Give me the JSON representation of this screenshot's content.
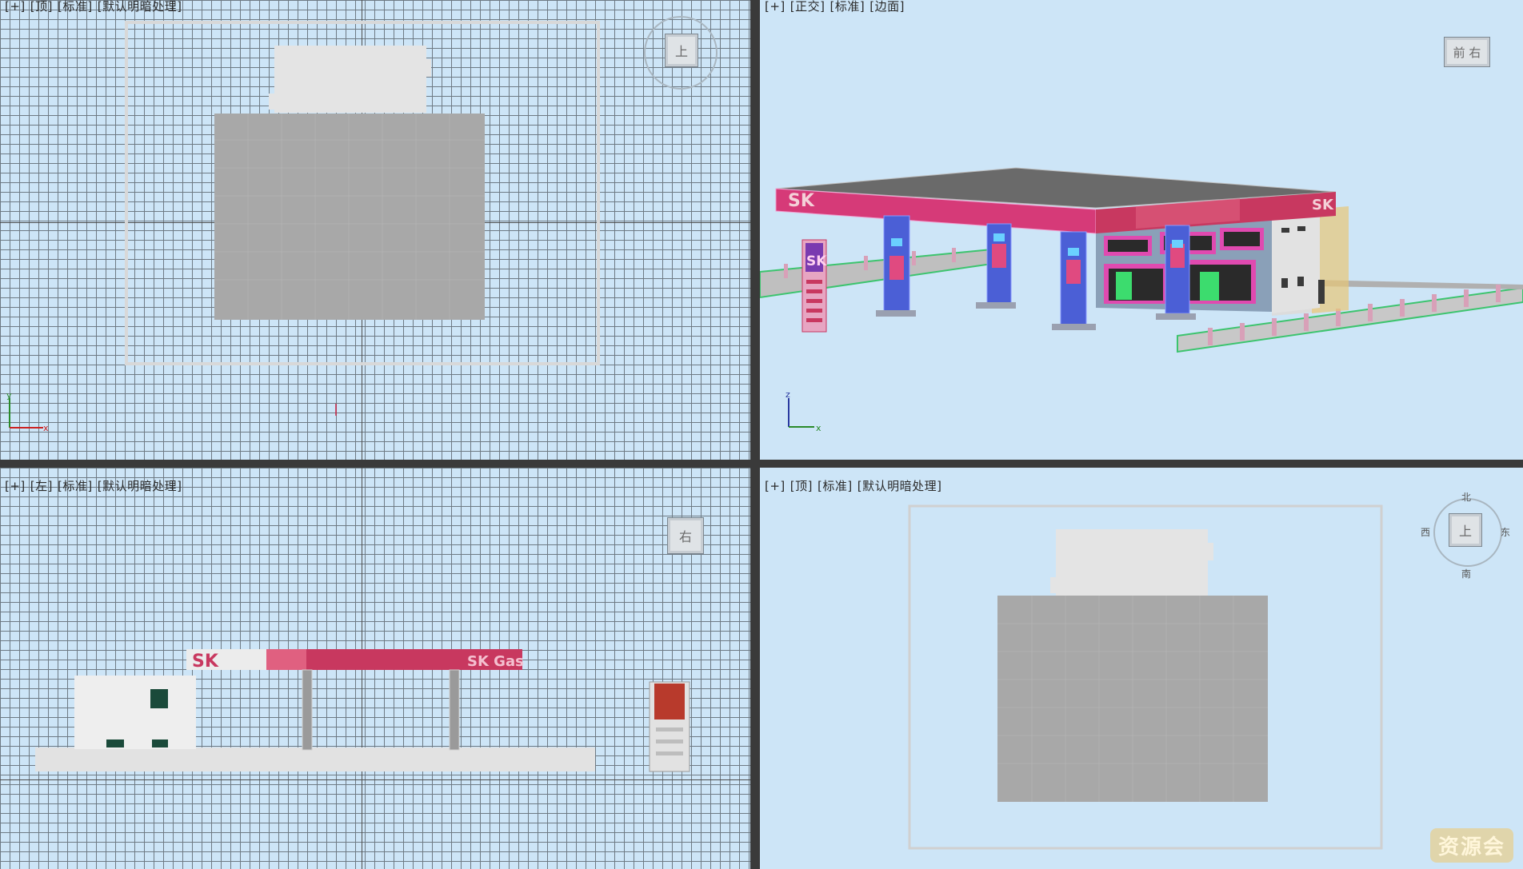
{
  "viewports": {
    "top": {
      "labels": [
        "[+]",
        "[顶]",
        "[标准]",
        "[默认明暗处理]"
      ],
      "nav_cube_face": "上",
      "axis": {
        "v": "y",
        "h": "x"
      }
    },
    "perspective": {
      "labels": [
        "[+]",
        "[正交]",
        "[标准]",
        "[边面]"
      ],
      "nav_cube_faces": [
        "前",
        "右"
      ],
      "axis": {
        "v": "z",
        "h": "x"
      },
      "sign_text": "SK",
      "canopy_text": "SK"
    },
    "left": {
      "labels": [
        "[+]",
        "[左]",
        "[标准]",
        "[默认明暗处理]"
      ],
      "nav_cube_face": "右",
      "canopy_text_left": "SK",
      "canopy_text_right": "SK Gas"
    },
    "bottom_right": {
      "labels": [
        "[+]",
        "[顶]",
        "[标准]",
        "[默认明暗处理]"
      ],
      "nav_cube_face": "上",
      "compass": {
        "north": "北",
        "south": "南",
        "east": "东",
        "west": "西"
      }
    }
  },
  "watermark": "资源会",
  "colors": {
    "viewport_bg": "#cde5f7",
    "grid_line": "#6e7a84",
    "roof_gray": "#a8a8a8",
    "canopy_red": "#c8385f",
    "building_white": "#e8e8e8",
    "column_blue": "#4b5fd6"
  }
}
